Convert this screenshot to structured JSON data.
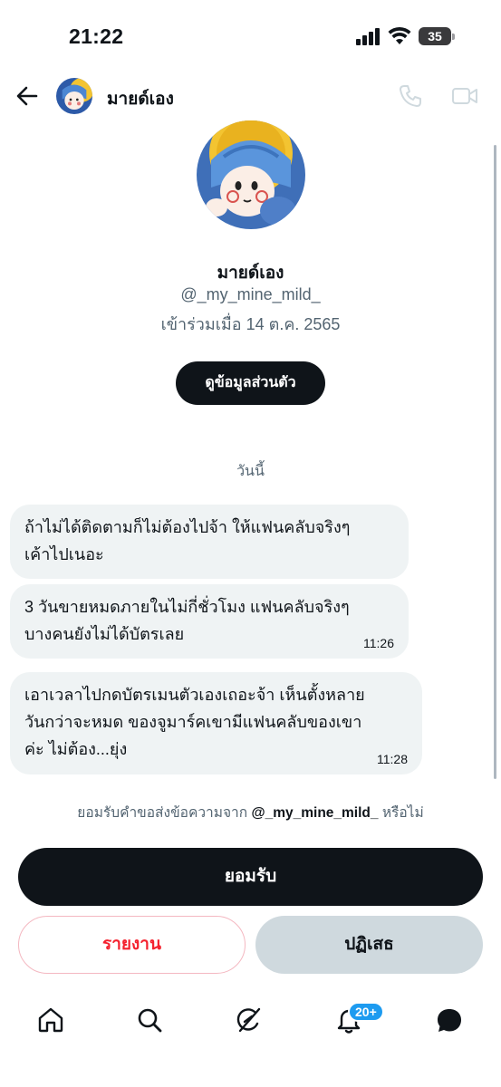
{
  "status_bar": {
    "time": "21:22",
    "battery": "35"
  },
  "header": {
    "name": "มายด์เอง"
  },
  "profile": {
    "name": "มายด์เอง",
    "handle": "@_my_mine_mild_",
    "joined": "เข้าร่วมเมื่อ 14 ต.ค. 2565",
    "view_profile_label": "ดูข้อมูลส่วนตัว"
  },
  "date_separator": "วันนี้",
  "messages": [
    {
      "text_line1": "ถ้าไม่ได้ติดตามก็ไม่ต้องไปจ้า ให้แฟนคลับจริงๆ",
      "text_line2": "เค้าไปเนอะ",
      "time": ""
    },
    {
      "text_line1": "3 วันขายหมดภายในไม่กี่ชั่วโมง แฟนคลับจริงๆ",
      "text_line2": "บางคนยังไม่ได้บัตรเลย",
      "time": "11:26"
    },
    {
      "text_line1": "เอาเวลาไปกดบัตรเมนตัวเองเถอะจ้า เห็นตั้งหลาย",
      "text_line2": "วันกว่าจะหมด ของจูมาร์คเขามีแฟนคลับของเขา",
      "text_line3": "ค่ะ ไม่ต้อง...ยุ่ง",
      "time": "11:28"
    }
  ],
  "request": {
    "prefix": "ยอมรับคำขอส่งข้อความจาก",
    "handle": "@_my_mine_mild_",
    "suffix": "หรือไม่"
  },
  "actions": {
    "accept": "ยอมรับ",
    "report": "รายงาน",
    "decline": "ปฏิเสธ"
  },
  "bottom_nav": {
    "notification_badge": "20+",
    "items": [
      "home-icon",
      "search-icon",
      "grok-icon",
      "bell-icon",
      "messages-icon"
    ]
  },
  "colors": {
    "primary": "#0f1419",
    "secondary_text": "#536471",
    "bubble": "#eff3f4",
    "report_red": "#f4212e",
    "decline_gray": "#cfd9de",
    "badge_blue": "#1d9bf0"
  }
}
